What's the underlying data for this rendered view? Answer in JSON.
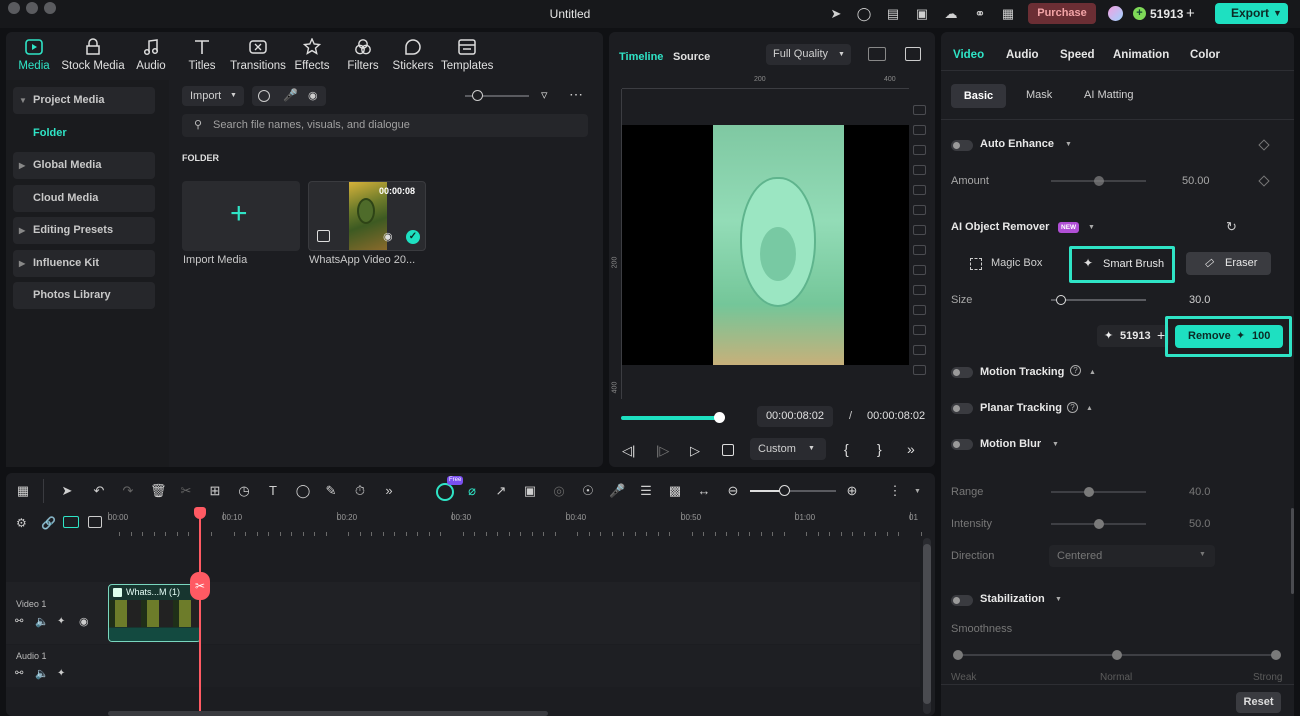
{
  "window": {
    "title": "Untitled"
  },
  "topbar": {
    "purchase_label": "Purchase",
    "credits": "51913",
    "export_label": "Export"
  },
  "toolbar": {
    "tabs": [
      {
        "label": "Media",
        "icon": "media-icon"
      },
      {
        "label": "Stock Media",
        "icon": "stock-media-icon"
      },
      {
        "label": "Audio",
        "icon": "music-note-icon"
      },
      {
        "label": "Titles",
        "icon": "text-t-icon"
      },
      {
        "label": "Transitions",
        "icon": "transitions-icon"
      },
      {
        "label": "Effects",
        "icon": "effects-star-icon"
      },
      {
        "label": "Filters",
        "icon": "filters-icon"
      },
      {
        "label": "Stickers",
        "icon": "stickers-icon"
      },
      {
        "label": "Templates",
        "icon": "templates-icon"
      }
    ]
  },
  "sidebar": {
    "items": [
      {
        "label": "Project Media"
      },
      {
        "label": "Folder"
      },
      {
        "label": "Global Media"
      },
      {
        "label": "Cloud Media"
      },
      {
        "label": "Editing Presets"
      },
      {
        "label": "Influence Kit"
      },
      {
        "label": "Photos Library"
      }
    ]
  },
  "media": {
    "import_label": "Import",
    "search_placeholder": "Search file names, visuals, and dialogue",
    "folder_heading": "FOLDER",
    "import_card_label": "Import Media",
    "clip_card_label": "WhatsApp Video 20...",
    "clip_duration": "00:00:08"
  },
  "preview": {
    "tab_timeline": "Timeline",
    "tab_source": "Source",
    "quality": "Full Quality",
    "ruler_top": [
      "200",
      "400"
    ],
    "ruler_left": [
      "200",
      "400"
    ],
    "current_time": "00:00:08:02",
    "separator": "/",
    "total_time": "00:00:08:02",
    "zoom_mode": "Custom",
    "progress": 1.0
  },
  "right_panel": {
    "tabs": [
      "Video",
      "Audio",
      "Speed",
      "Animation",
      "Color"
    ],
    "subtabs": [
      "Basic",
      "Mask",
      "AI Matting"
    ],
    "auto_enhance": {
      "title": "Auto Enhance",
      "amount_label": "Amount",
      "amount_value": "50.00",
      "level": 0.5
    },
    "object_remover": {
      "title": "AI Object Remover",
      "badge": "NEW",
      "magic_box": "Magic Box",
      "smart_brush": "Smart Brush",
      "eraser": "Eraser",
      "size_label": "Size",
      "size_value": "30.0",
      "size_level": 0.1,
      "credits": "51913",
      "remove_label": "Remove",
      "remove_cost": "100"
    },
    "motion_tracking": "Motion Tracking",
    "planar_tracking": "Planar Tracking",
    "motion_blur": {
      "title": "Motion Blur",
      "range_label": "Range",
      "range_value": "40.0",
      "range_level": 0.4,
      "intensity_label": "Intensity",
      "intensity_value": "50.0",
      "intensity_level": 0.5,
      "direction_label": "Direction",
      "direction_value": "Centered"
    },
    "stabilization": {
      "title": "Stabilization",
      "smoothness_label": "Smoothness",
      "marks": [
        "Weak",
        "Normal",
        "Strong"
      ]
    },
    "reset_label": "Reset"
  },
  "timeline": {
    "ai_badge": "Free",
    "ruler": [
      "00:00",
      "00:10",
      "00:20",
      "00:30",
      "00:40",
      "00:50",
      "01:00",
      "01"
    ],
    "tracks": [
      {
        "label": "Video 1"
      },
      {
        "label": "Audio 1"
      }
    ],
    "clip_title": "Whats...M (1)"
  },
  "colors": {
    "accent": "#1ee0c1",
    "highlight": "#2fe4c6",
    "playhead": "#ff5a63",
    "purchase_bg": "#6b2e34"
  }
}
